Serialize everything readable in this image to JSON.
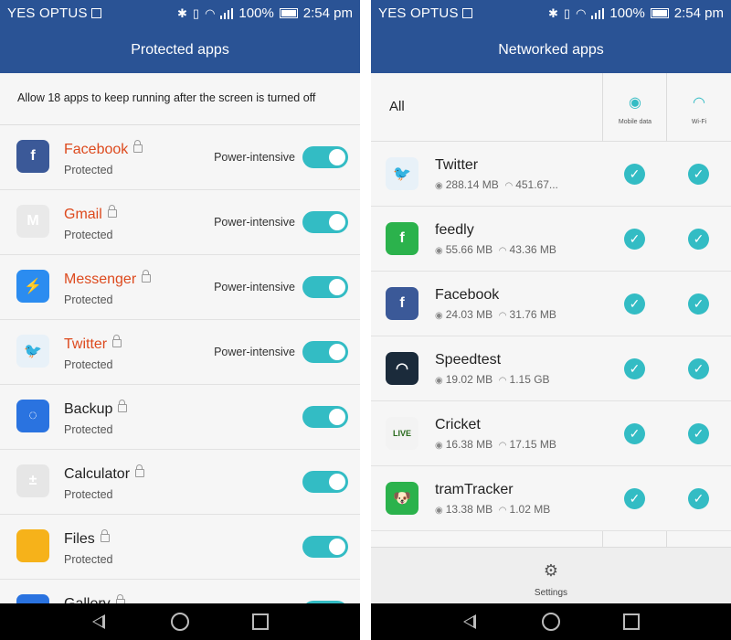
{
  "status": {
    "carrier": "YES OPTUS",
    "battery": "100%",
    "time": "2:54 pm"
  },
  "left": {
    "title": "Protected apps",
    "notice": "Allow 18 apps to keep running after the screen is turned off",
    "apps": [
      {
        "name": "Facebook",
        "status": "Protected",
        "tag": "Power-intensive",
        "highlight": true,
        "icon": "facebook-icon",
        "color": "#3b5998",
        "glyph": "f"
      },
      {
        "name": "Gmail",
        "status": "Protected",
        "tag": "Power-intensive",
        "highlight": true,
        "icon": "gmail-icon",
        "color": "#e9e9e9",
        "glyph": "M"
      },
      {
        "name": "Messenger",
        "status": "Protected",
        "tag": "Power-intensive",
        "highlight": true,
        "icon": "messenger-icon",
        "color": "#2b8cf0",
        "glyph": "⚡"
      },
      {
        "name": "Twitter",
        "status": "Protected",
        "tag": "Power-intensive",
        "highlight": true,
        "icon": "twitter-icon",
        "color": "#e8f1f8",
        "glyph": "🐦"
      },
      {
        "name": "Backup",
        "status": "Protected",
        "tag": "",
        "highlight": false,
        "icon": "backup-icon",
        "color": "#2a73e0",
        "glyph": "◌"
      },
      {
        "name": "Calculator",
        "status": "Protected",
        "tag": "",
        "highlight": false,
        "icon": "calculator-icon",
        "color": "#e6e6e6",
        "glyph": "±"
      },
      {
        "name": "Files",
        "status": "Protected",
        "tag": "",
        "highlight": false,
        "icon": "files-icon",
        "color": "#f6b21a",
        "glyph": ""
      },
      {
        "name": "Gallery",
        "status": "",
        "tag": "",
        "highlight": false,
        "icon": "gallery-icon",
        "color": "#2a73e0",
        "glyph": ""
      }
    ]
  },
  "right": {
    "title": "Networked apps",
    "all_label": "All",
    "col_mobile": "Mobile data",
    "col_wifi": "Wi-Fi",
    "settings_label": "Settings",
    "apps": [
      {
        "name": "Twitter",
        "mobile": "288.14 MB",
        "wifi": "451.67...",
        "icon": "twitter-icon",
        "color": "#e8f1f8",
        "glyph": "🐦"
      },
      {
        "name": "feedly",
        "mobile": "55.66 MB",
        "wifi": "43.36 MB",
        "icon": "feedly-icon",
        "color": "#2bb24c",
        "glyph": "f"
      },
      {
        "name": "Facebook",
        "mobile": "24.03 MB",
        "wifi": "31.76 MB",
        "icon": "facebook-icon",
        "color": "#3b5998",
        "glyph": "f"
      },
      {
        "name": "Speedtest",
        "mobile": "19.02 MB",
        "wifi": "1.15 GB",
        "icon": "speedtest-icon",
        "color": "#1b2b3b",
        "glyph": "◠"
      },
      {
        "name": "Cricket",
        "mobile": "16.38 MB",
        "wifi": "17.15 MB",
        "icon": "cricket-icon",
        "color": "#f3f3f3",
        "glyph": "LIVE"
      },
      {
        "name": "tramTracker",
        "mobile": "13.38 MB",
        "wifi": "1.02 MB",
        "icon": "tramtracker-icon",
        "color": "#2bb24c",
        "glyph": "🐶"
      }
    ]
  }
}
